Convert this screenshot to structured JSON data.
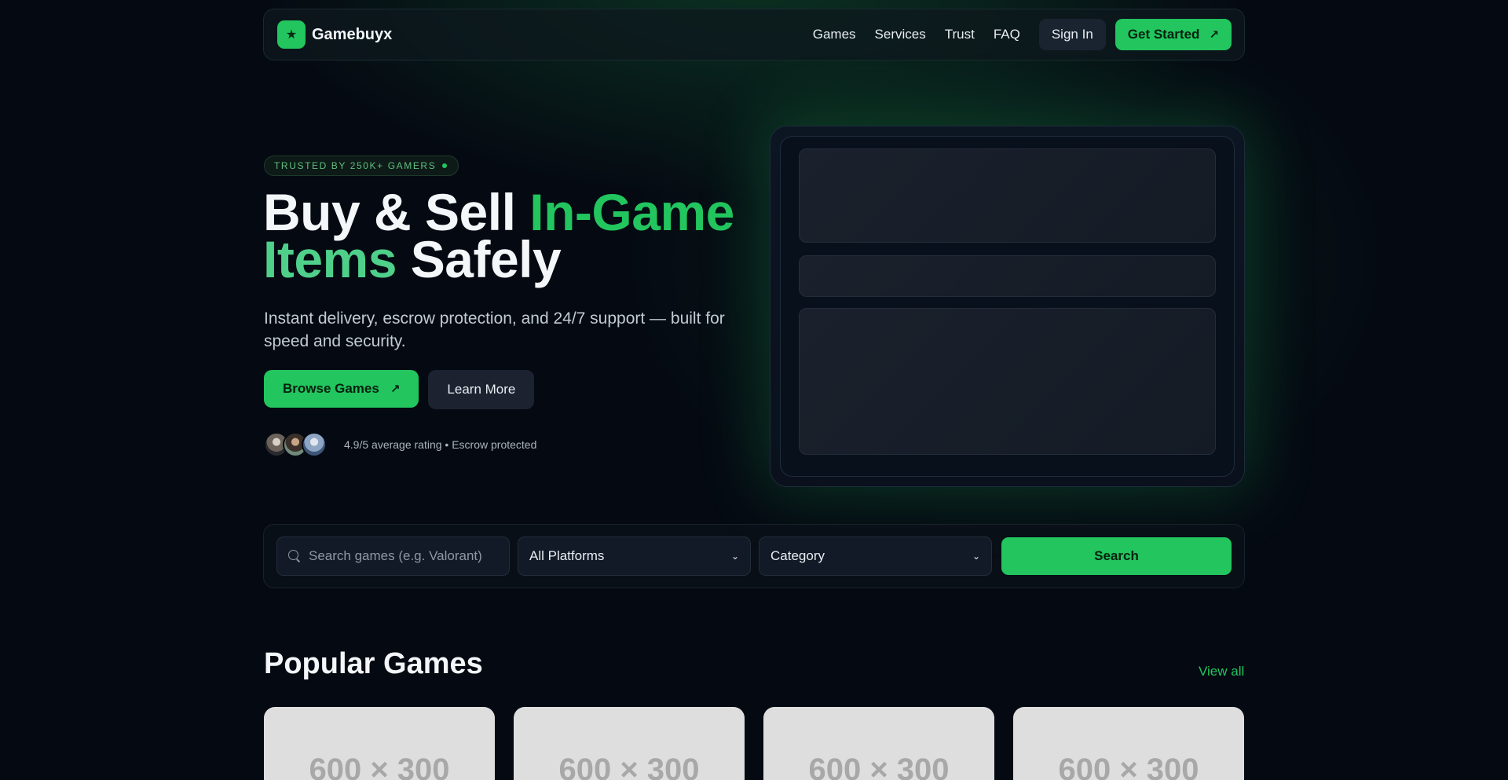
{
  "nav": {
    "brand": "Gamebuyx",
    "links": [
      "Games",
      "Services",
      "Trust",
      "FAQ"
    ],
    "sign_in": "Sign In",
    "get_started": "Get Started",
    "arrow": "↗"
  },
  "hero": {
    "badge": "TRUSTED BY 250K+ GAMERS",
    "headline": {
      "part1": "Buy & Sell ",
      "part2": "In-Game",
      "part3": "Items",
      "part4": " Safely"
    },
    "subtitle": "Instant delivery, escrow protection, and 24/7 support — built for speed and security.",
    "browse_label": "Browse Games",
    "learn_label": "Learn More",
    "rating_text": "4.9/5 average rating • Escrow protected"
  },
  "search": {
    "placeholder": "Search games (e.g. Valorant)",
    "platform_selected": "All Platforms",
    "category_selected": "Category",
    "button_label": "Search"
  },
  "popular": {
    "title": "Popular Games",
    "view_all": "View all",
    "cards": [
      "600 × 300",
      "600 × 300",
      "600 × 300",
      "600 × 300"
    ]
  },
  "colors": {
    "accent": "#22c55e",
    "background": "#050a12"
  }
}
